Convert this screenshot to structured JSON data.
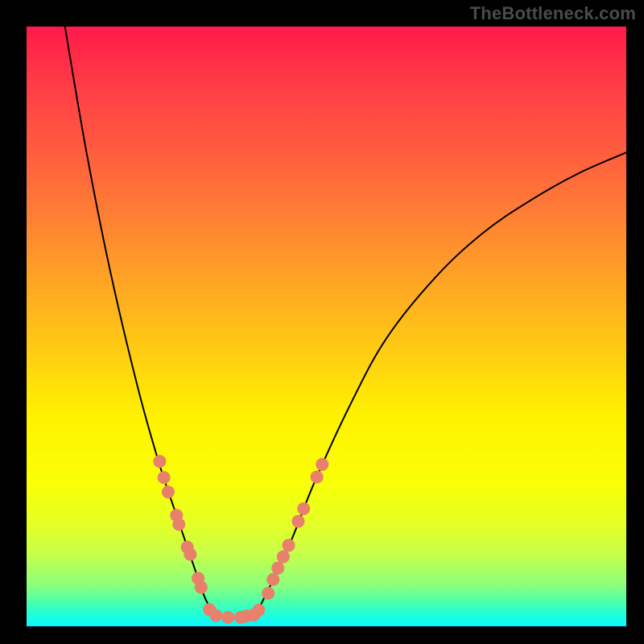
{
  "watermark": "TheBottleneck.com",
  "chart_data": {
    "type": "line",
    "title": "",
    "xlabel": "",
    "ylabel": "",
    "xlim": [
      0,
      100
    ],
    "ylim": [
      0,
      100
    ],
    "series": [
      {
        "name": "bottleneck-curve",
        "points": [
          {
            "x": 6.4,
            "y": 100.0
          },
          {
            "x": 10.0,
            "y": 79.0
          },
          {
            "x": 14.0,
            "y": 59.0
          },
          {
            "x": 18.5,
            "y": 40.0
          },
          {
            "x": 22.0,
            "y": 27.5
          },
          {
            "x": 25.0,
            "y": 18.5
          },
          {
            "x": 28.0,
            "y": 9.7
          },
          {
            "x": 30.0,
            "y": 4.2
          },
          {
            "x": 32.0,
            "y": 1.8
          },
          {
            "x": 34.0,
            "y": 1.5
          },
          {
            "x": 36.0,
            "y": 1.5
          },
          {
            "x": 38.0,
            "y": 2.0
          },
          {
            "x": 40.0,
            "y": 5.5
          },
          {
            "x": 44.0,
            "y": 14.0
          },
          {
            "x": 48.0,
            "y": 24.0
          },
          {
            "x": 54.0,
            "y": 37.0
          },
          {
            "x": 60.0,
            "y": 48.0
          },
          {
            "x": 68.0,
            "y": 58.0
          },
          {
            "x": 76.0,
            "y": 65.5
          },
          {
            "x": 84.0,
            "y": 71.0
          },
          {
            "x": 92.0,
            "y": 75.5
          },
          {
            "x": 100.0,
            "y": 79.0
          }
        ]
      },
      {
        "name": "markers-left",
        "points": [
          {
            "x": 22.2,
            "y": 27.5
          },
          {
            "x": 22.9,
            "y": 24.8
          },
          {
            "x": 23.6,
            "y": 22.4
          },
          {
            "x": 25.0,
            "y": 18.5
          },
          {
            "x": 25.4,
            "y": 17.0
          },
          {
            "x": 26.8,
            "y": 13.2
          },
          {
            "x": 27.3,
            "y": 12.0
          },
          {
            "x": 28.6,
            "y": 8.0
          },
          {
            "x": 29.1,
            "y": 6.5
          },
          {
            "x": 30.5,
            "y": 2.8
          },
          {
            "x": 31.6,
            "y": 1.8
          }
        ]
      },
      {
        "name": "markers-bottom",
        "points": [
          {
            "x": 33.6,
            "y": 1.5
          },
          {
            "x": 35.7,
            "y": 1.5
          },
          {
            "x": 36.6,
            "y": 1.7
          },
          {
            "x": 37.9,
            "y": 1.9
          },
          {
            "x": 38.7,
            "y": 2.7
          }
        ]
      },
      {
        "name": "markers-right",
        "points": [
          {
            "x": 40.3,
            "y": 5.5
          },
          {
            "x": 41.1,
            "y": 7.8
          },
          {
            "x": 41.9,
            "y": 9.7
          },
          {
            "x": 42.8,
            "y": 11.6
          },
          {
            "x": 43.7,
            "y": 13.5
          },
          {
            "x": 45.3,
            "y": 17.5
          },
          {
            "x": 46.2,
            "y": 19.6
          },
          {
            "x": 48.4,
            "y": 24.9
          },
          {
            "x": 49.3,
            "y": 27.0
          }
        ]
      }
    ]
  }
}
